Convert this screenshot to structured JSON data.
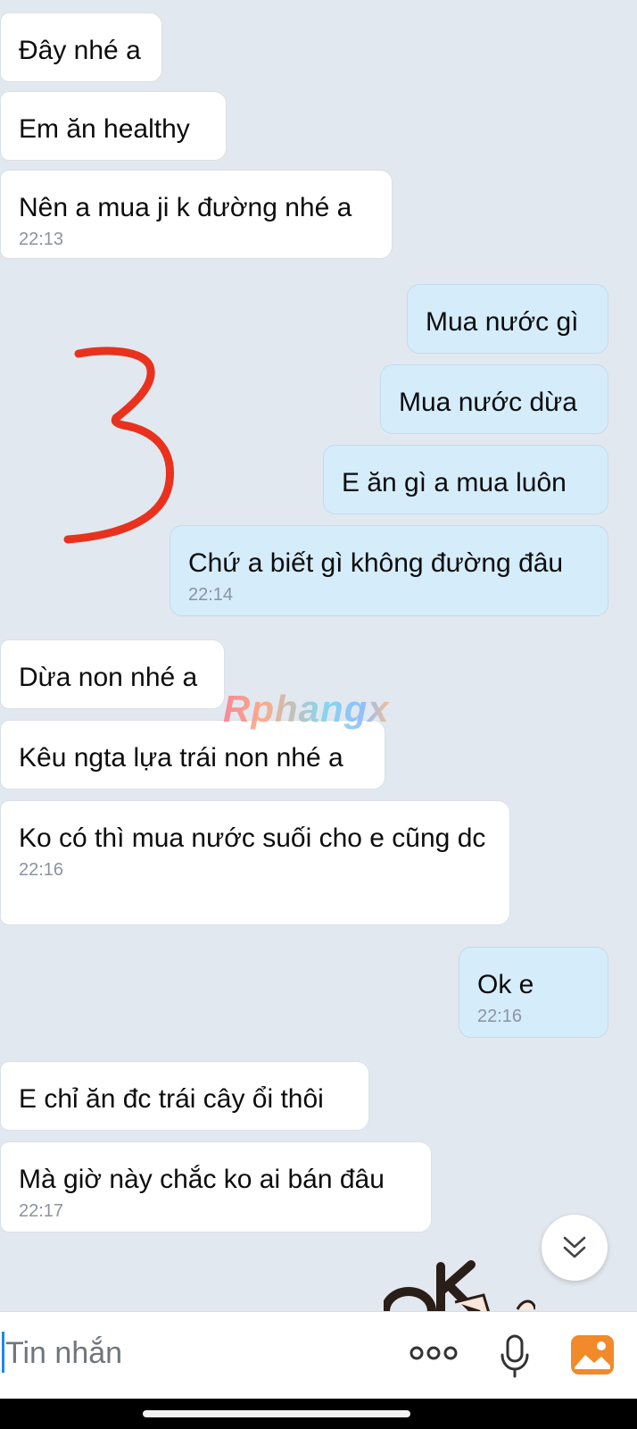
{
  "messages": [
    {
      "text": "Đây nhé a"
    },
    {
      "text": "Em ăn healthy"
    },
    {
      "text": "Nên a mua ji k đường nhé a",
      "time": "22:13"
    },
    {
      "text": "Mua nước gì"
    },
    {
      "text": "Mua nước dừa"
    },
    {
      "text": "E ăn gì a mua luôn"
    },
    {
      "text": "Chứ a biết gì không đường đâu",
      "time": "22:14"
    },
    {
      "text": "Dừa non nhé a"
    },
    {
      "text": "Kêu ngta lựa trái non nhé a"
    },
    {
      "text": "Ko có thì mua nước suối cho e cũng dc",
      "time": "22:16"
    },
    {
      "text": "Ok e",
      "time": "22:16"
    },
    {
      "text": "E chỉ ăn đc trái cây ổi thôi"
    },
    {
      "text": "Mà giờ này chắc ko ai bán đâu",
      "time": "22:17"
    }
  ],
  "watermark": "Rphangx",
  "sticker_text": "OK",
  "annotation_mark": "3",
  "input": {
    "placeholder": "Tin nhắn"
  },
  "icons": {
    "scroll": "chevron-double-down-icon",
    "more": "more-dots-icon",
    "mic": "microphone-icon",
    "gallery": "gallery-icon"
  },
  "colors": {
    "chat_background": "#e2e8ef",
    "incoming_bubble": "#ffffff",
    "outgoing_bubble": "#d5ecfb",
    "annotation": "#e8321e",
    "gallery_icon": "#f08a2a"
  }
}
